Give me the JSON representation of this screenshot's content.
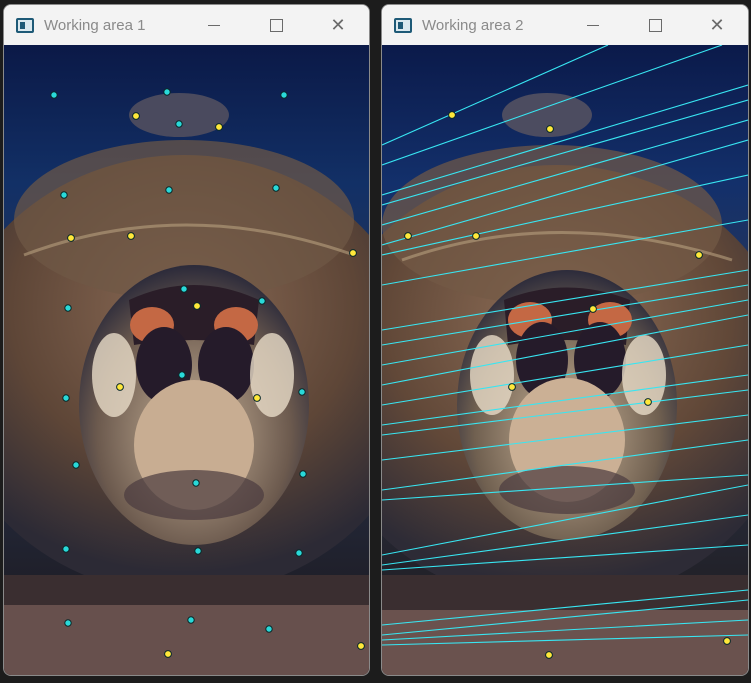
{
  "windows": [
    {
      "title": "Working area 1",
      "controls": {
        "minimize": "—",
        "maximize": "☐",
        "close": "✕"
      }
    },
    {
      "title": "Working area 2",
      "controls": {
        "minimize": "—",
        "maximize": "☐",
        "close": "✕"
      }
    }
  ],
  "image": {
    "subject": "sea turtle",
    "icon": "image-window-icon"
  },
  "colors": {
    "keypoint_cyan": "#29d9d9",
    "keypoint_yellow": "#ffe83a",
    "match_line": "#38e6f2",
    "water_dark": "#0a1d52",
    "shell_brown": "#6b4a3a"
  }
}
